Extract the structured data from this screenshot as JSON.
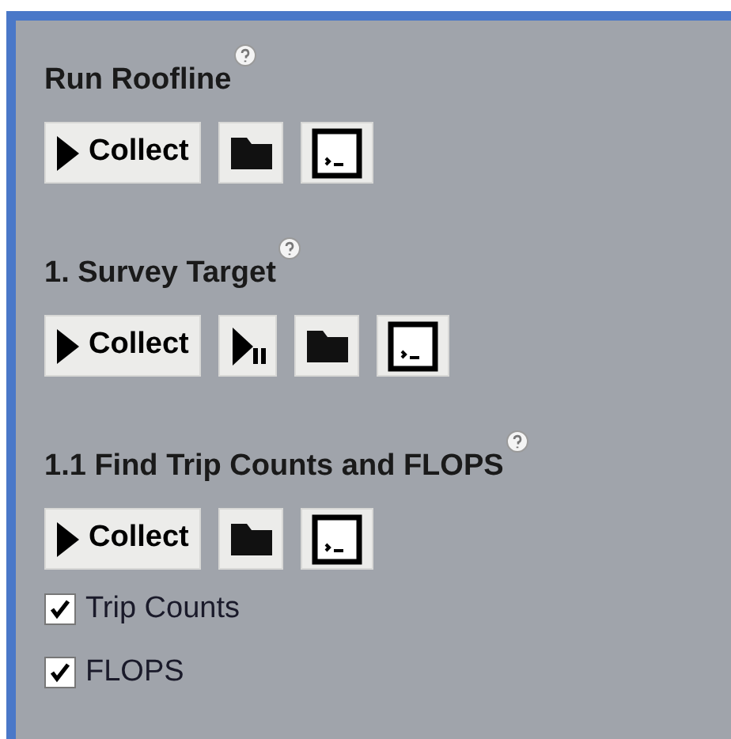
{
  "sections": [
    {
      "title": "Run Roofline",
      "buttons": [
        {
          "kind": "collect",
          "label": "Collect"
        },
        {
          "kind": "folder"
        },
        {
          "kind": "terminal"
        }
      ]
    },
    {
      "title": "1. Survey Target",
      "buttons": [
        {
          "kind": "collect",
          "label": "Collect"
        },
        {
          "kind": "run-pause"
        },
        {
          "kind": "folder"
        },
        {
          "kind": "terminal"
        }
      ]
    },
    {
      "title": "1.1 Find Trip Counts and FLOPS",
      "buttons": [
        {
          "kind": "collect",
          "label": "Collect"
        },
        {
          "kind": "folder"
        },
        {
          "kind": "terminal"
        }
      ],
      "checkboxes": [
        {
          "label": "Trip Counts",
          "checked": true
        },
        {
          "label": "FLOPS",
          "checked": true
        }
      ]
    }
  ]
}
